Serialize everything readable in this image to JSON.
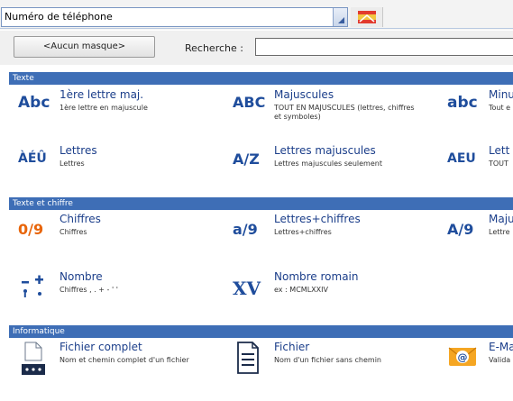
{
  "topbar": {
    "combo_value": "Numéro de téléphone"
  },
  "search": {
    "mask_button": "<Aucun masque>",
    "label": "Recherche :",
    "value": ""
  },
  "sections": [
    {
      "label": "Texte"
    },
    {
      "label": "Texte et chiffre"
    },
    {
      "label": "Informatique"
    }
  ],
  "items": [
    {
      "icon": "Abc",
      "title": "1ère lettre maj.",
      "desc": "1ère lettre en majuscule"
    },
    {
      "icon": "ABC",
      "title": "Majuscules",
      "desc": "TOUT EN MAJUSCULES (lettres, chiffres et symboles)"
    },
    {
      "icon": "abc",
      "title": "Minu",
      "desc": "Tout e"
    },
    {
      "icon": "ÀÉÛ",
      "title": "Lettres",
      "desc": "Lettres"
    },
    {
      "icon": "A/Z",
      "title": "Lettres majuscules",
      "desc": "Lettres majuscules seulement"
    },
    {
      "icon": "AEU",
      "title": "Lett",
      "desc": "TOUT"
    },
    {
      "icon": "0/9",
      "title": "Chiffres",
      "desc": "Chiffres"
    },
    {
      "icon": "a/9",
      "title": "Lettres+chiffres",
      "desc": "Lettres+chiffres"
    },
    {
      "icon": "A/9",
      "title": "Maju",
      "desc": "Lettre"
    },
    {
      "icon": "-+;•",
      "title": "Nombre",
      "desc": "Chiffres , . + - ' '"
    },
    {
      "icon": "XV",
      "title": "Nombre romain",
      "desc": "ex : MCMLXXIV"
    },
    {
      "icon": "...",
      "title": "Fichier complet",
      "desc": "Nom et chemin complet d'un fichier"
    },
    {
      "icon": "file",
      "title": "Fichier",
      "desc": "Nom d'un fichier sans chemin"
    },
    {
      "icon": "@",
      "title": "E-Ma",
      "desc": "Valida"
    }
  ],
  "colors": {
    "section_bar": "#3e6eb6",
    "title_blue": "#1b3e8a",
    "icon_blue": "#1f4d9c",
    "icon_orange": "#e8650a",
    "icon_green": "#2f8f2f"
  }
}
